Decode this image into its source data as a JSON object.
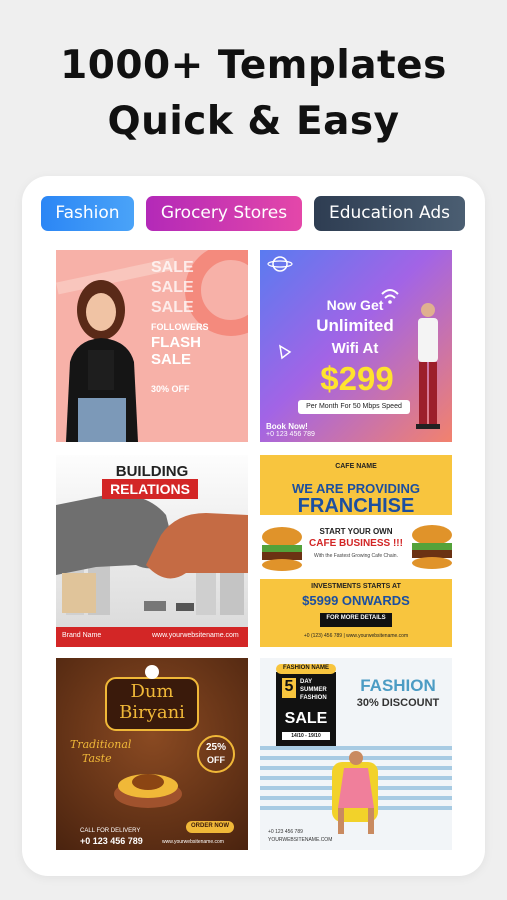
{
  "headline": {
    "line1": "1000+ Templates",
    "line2": "Quick & Easy"
  },
  "categories": [
    "Fashion",
    "Grocery Stores",
    "Education Ads"
  ],
  "templates": {
    "flash_sale": {
      "sale_words": [
        "SALE",
        "SALE",
        "SALE"
      ],
      "followers": "FOLLOWERS",
      "flash": "FLASH",
      "sale": "SALE",
      "off": "30% OFF"
    },
    "wifi": {
      "line1": "Now Get",
      "line2": "Unlimited",
      "line3": "Wifi At",
      "price": "$299",
      "sub": "Per Month For 50 Mbps Speed",
      "book": "Book Now!",
      "phone": "+0 123 456 789"
    },
    "building": {
      "line1": "BUILDING",
      "line2": "RELATIONS",
      "brand": "Brand Name",
      "site": "www.yourwebsitename.com"
    },
    "franchise": {
      "cafe_name": "CAFE NAME",
      "line1": "WE ARE PROVIDING",
      "line2": "FRANCHISE",
      "start": "START YOUR OWN",
      "business": "CAFE BUSINESS !!!",
      "fastest": "With the Fastest Growing Cafe Chain.",
      "investments": "INVESTMENTS STARTS AT",
      "amount": "$5999 ONWARDS",
      "details": "FOR MORE DETAILS",
      "footer": "+0 (123) 456 789 | www.yourwebsitename.com"
    },
    "biryani": {
      "line1": "Dum",
      "line2": "Biryani",
      "traditional": "Traditional",
      "taste": "Taste",
      "pct": "25%",
      "off": "OFF",
      "call": "CALL FOR DELIVERY",
      "phone": "+0 123 456 789",
      "order": "ORDER NOW",
      "site": "www.yourwebsitename.com"
    },
    "fashion_discount": {
      "fashion_name": "FASHION NAME",
      "day_num": "5",
      "day": "DAY",
      "summer": "SUMMER",
      "fashion_small": "FASHION",
      "sale": "SALE",
      "dates": "14/10 - 19/10",
      "title": "FASHION",
      "discount": "30% DISCOUNT",
      "phone": "+0 123 456 789",
      "site": "YOURWEBSITENAME.COM"
    }
  },
  "colors": {
    "fashion_chip": "#2b86f5",
    "grocery_chip": "#c635b4",
    "education_chip": "#3a4a5e",
    "price_yellow": "#ffe32e",
    "franchise_blue": "#1c4fa0"
  }
}
